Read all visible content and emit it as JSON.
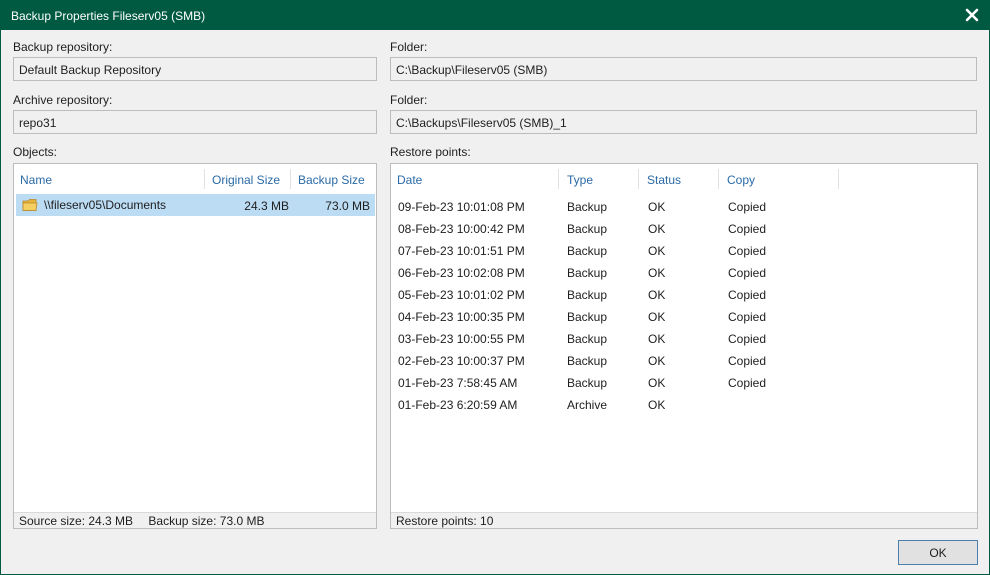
{
  "window": {
    "title": "Backup Properties Fileserv05 (SMB)"
  },
  "backup_repository": {
    "label": "Backup repository:",
    "value": "Default Backup Repository"
  },
  "backup_folder": {
    "label": "Folder:",
    "value": "C:\\Backup\\Fileserv05 (SMB)"
  },
  "archive_repository": {
    "label": "Archive repository:",
    "value": "repo31"
  },
  "archive_folder": {
    "label": "Folder:",
    "value": "C:\\Backups\\Fileserv05 (SMB)_1"
  },
  "objects": {
    "label": "Objects:",
    "columns": [
      "Name",
      "Original Size",
      "Backup Size"
    ],
    "rows": [
      {
        "name": "\\\\fileserv05\\Documents",
        "original_size": "24.3 MB",
        "backup_size": "73.0 MB",
        "icon": "folder-icon"
      }
    ],
    "footer": {
      "source_size": "Source size: 24.3 MB",
      "backup_size": "Backup size: 73.0 MB"
    }
  },
  "restore_points": {
    "label": "Restore points:",
    "columns": [
      "Date",
      "Type",
      "Status",
      "Copy"
    ],
    "rows": [
      {
        "date": "09-Feb-23 10:01:08 PM",
        "type": "Backup",
        "status": "OK",
        "copy": "Copied"
      },
      {
        "date": "08-Feb-23 10:00:42 PM",
        "type": "Backup",
        "status": "OK",
        "copy": "Copied"
      },
      {
        "date": "07-Feb-23 10:01:51 PM",
        "type": "Backup",
        "status": "OK",
        "copy": "Copied"
      },
      {
        "date": "06-Feb-23 10:02:08 PM",
        "type": "Backup",
        "status": "OK",
        "copy": "Copied"
      },
      {
        "date": "05-Feb-23 10:01:02 PM",
        "type": "Backup",
        "status": "OK",
        "copy": "Copied"
      },
      {
        "date": "04-Feb-23 10:00:35 PM",
        "type": "Backup",
        "status": "OK",
        "copy": "Copied"
      },
      {
        "date": "03-Feb-23 10:00:55 PM",
        "type": "Backup",
        "status": "OK",
        "copy": "Copied"
      },
      {
        "date": "02-Feb-23 10:00:37 PM",
        "type": "Backup",
        "status": "OK",
        "copy": "Copied"
      },
      {
        "date": "01-Feb-23 7:58:45 AM",
        "type": "Backup",
        "status": "OK",
        "copy": "Copied"
      },
      {
        "date": "01-Feb-23 6:20:59 AM",
        "type": "Archive",
        "status": "OK",
        "copy": ""
      }
    ],
    "footer": "Restore points: 10"
  },
  "buttons": {
    "ok": "OK"
  },
  "colors": {
    "titlebar": "#005a41",
    "header_text": "#2a6aa6",
    "selection": "#bcdcf4"
  }
}
